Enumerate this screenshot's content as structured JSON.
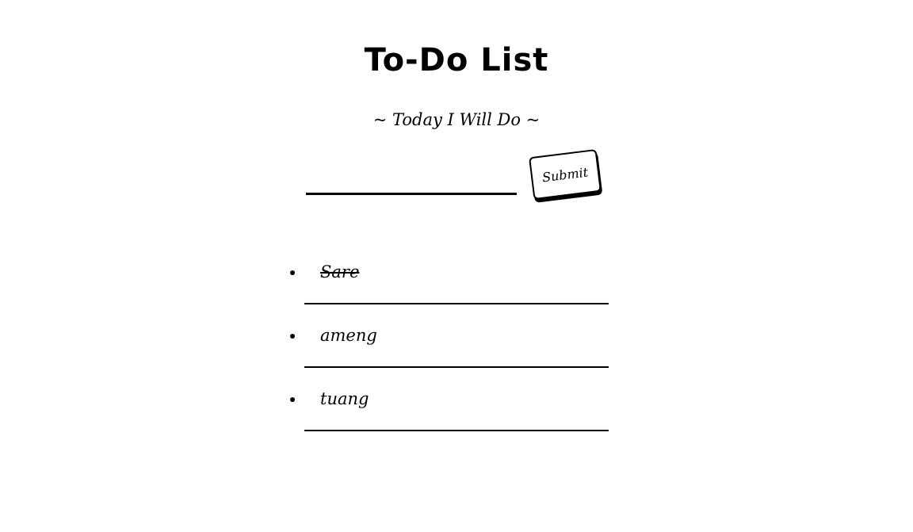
{
  "header": {
    "title": "To-Do List",
    "subtitle": "~ Today I Will Do ~"
  },
  "form": {
    "input_value": "",
    "input_placeholder": "",
    "submit_label": "Submit"
  },
  "todos": [
    {
      "text": "Sare",
      "done": true
    },
    {
      "text": "ameng",
      "done": false
    },
    {
      "text": "tuang",
      "done": false
    }
  ]
}
